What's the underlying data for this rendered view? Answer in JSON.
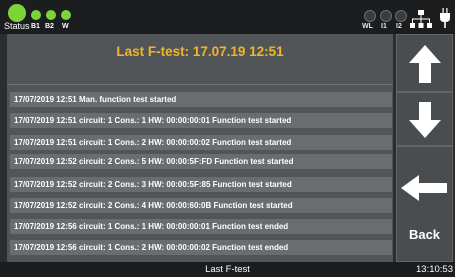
{
  "status_bar": {
    "status_label": "Status",
    "indicators_left": [
      "B1",
      "B2",
      "W"
    ],
    "indicators_right": [
      "WL",
      "I1",
      "I2"
    ],
    "led_color_active": "#7cd43a",
    "icons": [
      "network-icon",
      "plug-icon"
    ]
  },
  "main": {
    "title": "Last F-test: 17.07.19  12:51",
    "title_color": "#f1b52b",
    "log": [
      "17/07/2019  12:51  Man. function test started",
      "17/07/2019  12:51  circuit:  1  Cons.:  1  HW: 00:00:00:01  Function test started",
      "17/07/2019  12:51  circuit:  1  Cons.:  2  HW: 00:00:00:02  Function test started",
      "17/07/2019  12:52  circuit:  2  Cons.:  5  HW: 00:00:5F:FD  Function test started",
      "17/07/2019  12:52  circuit:  2  Cons.:  3  HW: 00:00:5F:85  Function test started",
      "17/07/2019  12:52  circuit:  2  Cons.:  4  HW: 00:00:60:0B  Function test started",
      "17/07/2019  12:56  circuit:  1  Cons.:  1  HW: 00:00:00:01  Function test ended",
      "17/07/2019  12:56  circuit:  1  Cons.:  2  HW: 00:00:00:02  Function test ended"
    ]
  },
  "buttons": {
    "back_label": "Back",
    "icons": [
      "arrow-up-icon",
      "arrow-down-icon",
      "arrow-left-icon"
    ]
  },
  "footer": {
    "title": "Last F-test",
    "clock": "13:10:53"
  }
}
